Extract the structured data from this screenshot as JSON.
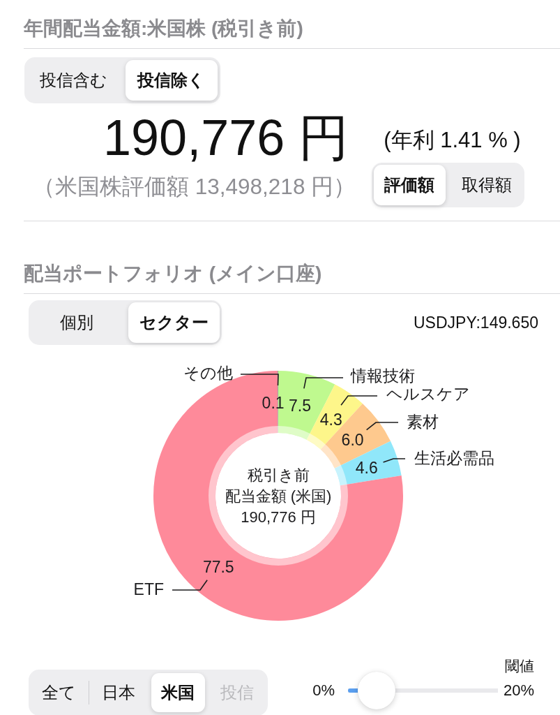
{
  "annual_dividend": {
    "title": "年間配当金額:米国株 (税引き前)",
    "fund_filter": [
      {
        "label": "投信含む",
        "selected": false
      },
      {
        "label": "投信除く",
        "selected": true
      }
    ],
    "amount": "190,776 円",
    "yield": "(年利 1.41 % )",
    "valuation": "（米国株評価額 13,498,218 円）",
    "basis": [
      {
        "label": "評価額",
        "selected": true
      },
      {
        "label": "取得額",
        "selected": false
      }
    ]
  },
  "portfolio": {
    "title": "配当ポートフォリオ (メイン口座)",
    "view": [
      {
        "label": "個別",
        "selected": false
      },
      {
        "label": "セクター",
        "selected": true
      }
    ],
    "exchange_rate": "USDJPY:149.650",
    "chart_data": {
      "type": "donut",
      "categories": [
        "情報技術",
        "ヘルスケア",
        "素材",
        "生活必需品",
        "ETF",
        "その他"
      ],
      "values": [
        7.5,
        4.3,
        6.0,
        4.6,
        77.5,
        0.1
      ],
      "value_labels": [
        "7.5",
        "4.3",
        "6.0",
        "4.6",
        "77.5",
        "0.1"
      ],
      "colors": [
        "#bff98f",
        "#fdf68a",
        "#fec98e",
        "#90e7fa",
        "#fe8a9a",
        "#9e9e9e"
      ]
    },
    "center_label": [
      "税引き前",
      "配当金額 (米国)",
      "190,776 円"
    ],
    "market_filter": [
      {
        "label": "全て",
        "selected": false,
        "disabled": false
      },
      {
        "label": "日本",
        "selected": false,
        "disabled": false
      },
      {
        "label": "米国",
        "selected": true,
        "disabled": false
      },
      {
        "label": "投信",
        "selected": false,
        "disabled": true
      }
    ],
    "threshold": {
      "label": "閾値",
      "min_label": "0%",
      "max_label": "20%",
      "level": 0.09
    }
  }
}
